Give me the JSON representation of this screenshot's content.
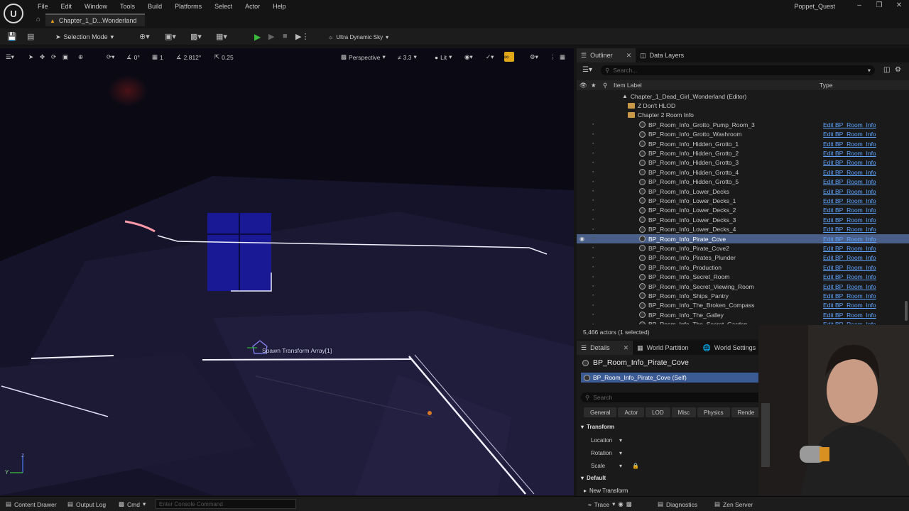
{
  "app": {
    "project_name": "Poppet_Quest",
    "menu": [
      "File",
      "Edit",
      "Window",
      "Tools",
      "Build",
      "Platforms",
      "Select",
      "Actor",
      "Help"
    ],
    "level_tab": "Chapter_1_D...Wonderland",
    "logo_icon": "unreal-logo-icon"
  },
  "toolbar": {
    "selection_mode": "Selection Mode",
    "sky": "Ultra Dynamic Sky"
  },
  "viewport": {
    "translate_snap": "0°",
    "grid_snap": "1",
    "camera_speed": "2.812°",
    "scale_snap": "0.25",
    "view_mode_perspective": "Perspective",
    "fov": "3.3",
    "lighting": "Lit",
    "spawn_label": "Spawn Transform Array[1]",
    "axis_z": "z",
    "axis_y": "Y",
    "colors": {
      "snap_active": "#e0a818",
      "scene_bg": "#0b0a14"
    }
  },
  "outliner": {
    "tabs": [
      {
        "label": "Outliner",
        "icon": "outliner-icon"
      },
      {
        "label": "Data Layers",
        "icon": "data-layers-icon"
      }
    ],
    "search_placeholder": "Search...",
    "col_label": "Item Label",
    "col_type": "Type",
    "tree": [
      {
        "label": "Chapter_1_Dead_Girl_Wonderland (Editor)",
        "kind": "world",
        "depth": 0
      },
      {
        "label": "Z Don't HLOD",
        "kind": "folder",
        "depth": 1
      },
      {
        "label": "Chapter 2 Room Info",
        "kind": "folder",
        "depth": 1
      }
    ],
    "actors": [
      {
        "label": "BP_Room_Info_Grotto_Pump_Room_3",
        "type": "Edit BP_Room_Info"
      },
      {
        "label": "BP_Room_Info_Grotto_Washroom",
        "type": "Edit BP_Room_Info"
      },
      {
        "label": "BP_Room_Info_Hidden_Grotto_1",
        "type": "Edit BP_Room_Info"
      },
      {
        "label": "BP_Room_Info_Hidden_Grotto_2",
        "type": "Edit BP_Room_Info"
      },
      {
        "label": "BP_Room_Info_Hidden_Grotto_3",
        "type": "Edit BP_Room_Info"
      },
      {
        "label": "BP_Room_Info_Hidden_Grotto_4",
        "type": "Edit BP_Room_Info"
      },
      {
        "label": "BP_Room_Info_Hidden_Grotto_5",
        "type": "Edit BP_Room_Info"
      },
      {
        "label": "BP_Room_Info_Lower_Decks",
        "type": "Edit BP_Room_Info"
      },
      {
        "label": "BP_Room_Info_Lower_Decks_1",
        "type": "Edit BP_Room_Info"
      },
      {
        "label": "BP_Room_Info_Lower_Decks_2",
        "type": "Edit BP_Room_Info"
      },
      {
        "label": "BP_Room_Info_Lower_Decks_3",
        "type": "Edit BP_Room_Info"
      },
      {
        "label": "BP_Room_Info_Lower_Decks_4",
        "type": "Edit BP_Room_Info"
      },
      {
        "label": "BP_Room_Info_Pirate_Cove",
        "type": "Edit BP_Room_Info",
        "selected": true
      },
      {
        "label": "BP_Room_Info_Pirate_Cove2",
        "type": "Edit BP_Room_Info"
      },
      {
        "label": "BP_Room_Info_Pirates_Plunder",
        "type": "Edit BP_Room_Info"
      },
      {
        "label": "BP_Room_Info_Production",
        "type": "Edit BP_Room_Info"
      },
      {
        "label": "BP_Room_Info_Secret_Room",
        "type": "Edit BP_Room_Info"
      },
      {
        "label": "BP_Room_Info_Secret_Viewing_Room",
        "type": "Edit BP_Room_Info"
      },
      {
        "label": "BP_Room_Info_Ships_Pantry",
        "type": "Edit BP_Room_Info"
      },
      {
        "label": "BP_Room_Info_The_Broken_Compass",
        "type": "Edit BP_Room_Info"
      },
      {
        "label": "BP_Room_Info_The_Galley",
        "type": "Edit BP_Room_Info"
      },
      {
        "label": "BP_Room_Info_The_Secret_Garden",
        "type": "Edit BP_Room_Info"
      }
    ],
    "actor_count": "5,466 actors (1 selected)",
    "colors": {
      "selected_row": "#4a5f87",
      "type_link": "#5ea3ff",
      "folder": "#c89848"
    }
  },
  "details": {
    "tabs": [
      {
        "label": "Details",
        "icon": "details-icon"
      },
      {
        "label": "World Partition",
        "icon": "world-partition-icon"
      },
      {
        "label": "World Settings",
        "icon": "world-settings-icon"
      }
    ],
    "object_name": "BP_Room_Info_Pirate_Cove",
    "self_component": "BP_Room_Info_Pirate_Cove (Self)",
    "search_placeholder": "Search",
    "filters": [
      "General",
      "Actor",
      "LOD",
      "Misc",
      "Physics",
      "Rende"
    ],
    "transform_section": "Transform",
    "location": "Location",
    "rotation": "Rotation",
    "scale": "Scale",
    "default_section": "Default",
    "new_transform": "New Transform"
  },
  "statusbar": {
    "content_drawer": "Content Drawer",
    "output_log": "Output Log",
    "cmd": "Cmd",
    "console_placeholder": "Enter Console Command",
    "trace": "Trace",
    "diagnostics": "Diagnostics",
    "zen_server": "Zen Server"
  }
}
